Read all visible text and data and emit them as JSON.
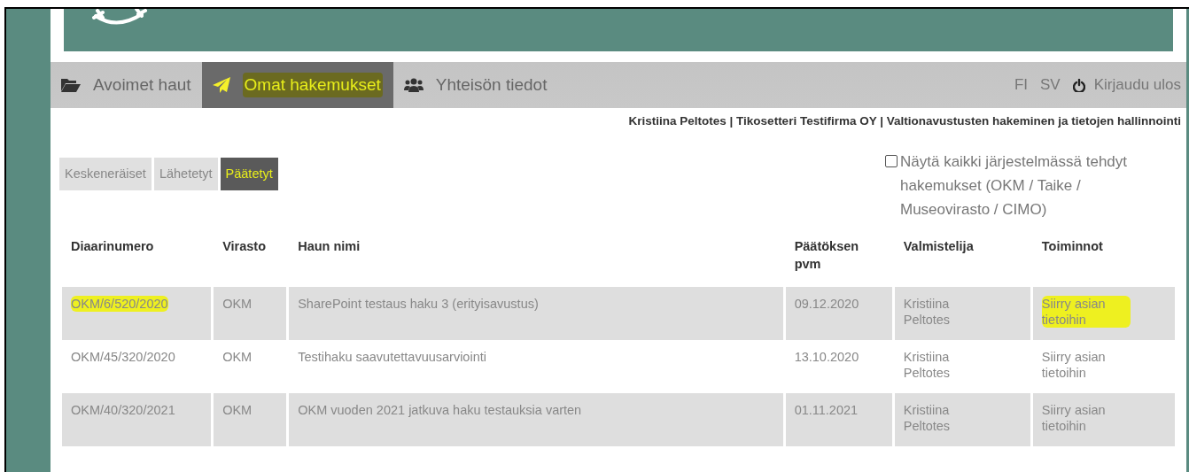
{
  "nav": {
    "tabs": [
      {
        "label": "Avoimet haut",
        "selected": false,
        "highlighted": false
      },
      {
        "label": "Omat hakemukset",
        "selected": true,
        "highlighted": true
      },
      {
        "label": "Yhteisön tiedot",
        "selected": false,
        "highlighted": false
      }
    ],
    "languages": [
      "FI",
      "SV"
    ],
    "logout": "Kirjaudu ulos"
  },
  "user_line": "Kristiina Peltotes | Tikosetteri Testifirma OY | Valtionavustusten hakeminen ja tietojen hallinnointi",
  "subtabs": [
    {
      "label": "Keskeneräiset",
      "selected": false,
      "highlighted": false
    },
    {
      "label": "Lähetetyt",
      "selected": false,
      "highlighted": false
    },
    {
      "label": "Päätetyt",
      "selected": true,
      "highlighted": true
    }
  ],
  "show_all": {
    "label": "Näytä kaikki järjestelmässä tehdyt hakemukset (OKM / Taike / Museovirasto / CIMO)",
    "checked": false
  },
  "table": {
    "columns": [
      "Diaarinumero",
      "Virasto",
      "Haun nimi",
      "Päätöksen pvm",
      "Valmistelija",
      "Toiminnot"
    ],
    "rows": [
      {
        "cells": [
          {
            "text": "OKM/6/520/2020",
            "highlighted": true
          },
          {
            "text": "OKM",
            "highlighted": false
          },
          {
            "text": "SharePoint testaus haku 3 (erityisavustus)",
            "highlighted": false
          },
          {
            "text": "09.12.2020",
            "highlighted": false
          },
          {
            "text": "Kristiina Peltotes",
            "highlighted": false
          },
          {
            "text": "Siirry asian tietoihin",
            "highlighted": true
          }
        ]
      },
      {
        "cells": [
          {
            "text": "OKM/45/320/2020",
            "highlighted": false
          },
          {
            "text": "OKM",
            "highlighted": false
          },
          {
            "text": "Testihaku saavutettavuusarviointi",
            "highlighted": false
          },
          {
            "text": "13.10.2020",
            "highlighted": false
          },
          {
            "text": "Kristiina Peltotes",
            "highlighted": false
          },
          {
            "text": "Siirry asian tietoihin",
            "highlighted": false
          }
        ]
      },
      {
        "cells": [
          {
            "text": "OKM/40/320/2021",
            "highlighted": false
          },
          {
            "text": "OKM",
            "highlighted": false
          },
          {
            "text": "OKM vuoden 2021 jatkuva haku testauksia varten",
            "highlighted": false
          },
          {
            "text": "01.11.2021",
            "highlighted": false
          },
          {
            "text": "Kristiina Peltotes",
            "highlighted": false
          },
          {
            "text": "Siirry asian tietoihin",
            "highlighted": false
          }
        ]
      }
    ]
  }
}
